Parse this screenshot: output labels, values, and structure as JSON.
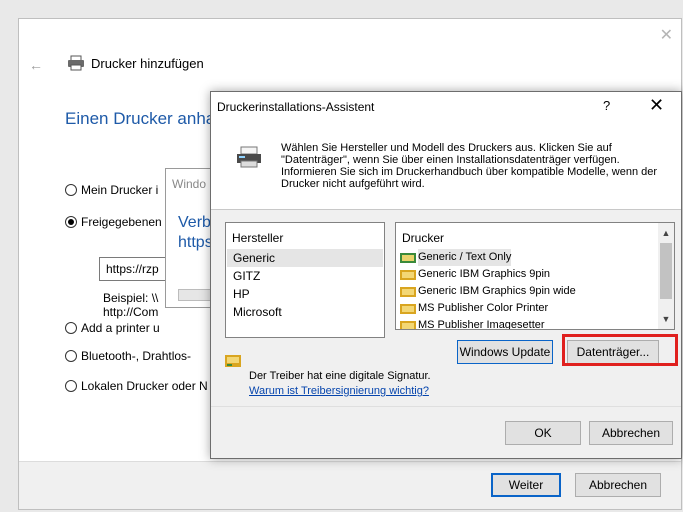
{
  "outer": {
    "title": "Drucker hinzufügen",
    "close_glyph": "✕",
    "back_glyph": "←",
    "heading": "Einen Drucker anha",
    "options": [
      {
        "label": "Mein Drucker i",
        "selected": false
      },
      {
        "label": "Freigegebenen",
        "selected": true
      },
      {
        "label": "Add a printer u",
        "selected": false
      },
      {
        "label": "Bluetooth-, Drahtlos-",
        "selected": false
      },
      {
        "label": "Lokalen Drucker oder N",
        "selected": false
      }
    ],
    "url_value": "https://rzp",
    "example_line1": "Beispiel: \\\\",
    "example_line2": "http://Com",
    "next_button": "Weiter",
    "cancel_button": "Abbrechen"
  },
  "middle": {
    "title": "Windo",
    "heading_line1": "Verb",
    "heading_line2": "https"
  },
  "dialog": {
    "title": "Druckerinstallations-Assistent",
    "help_glyph": "?",
    "close_glyph": "✕",
    "description": "Wählen Sie Hersteller und Modell des Druckers aus. Klicken Sie auf\n\"Datenträger\", wenn Sie über einen Installationsdatenträger verfügen.\nInformieren Sie sich im Druckerhandbuch über kompatible Modelle, wenn der\nDrucker nicht aufgeführt wird.",
    "manufacturer_header": "Hersteller",
    "manufacturers": [
      "Generic",
      "GITZ",
      "HP",
      "Microsoft"
    ],
    "selected_manufacturer": "Generic",
    "printer_header": "Drucker",
    "printers": [
      "Generic / Text Only",
      "Generic IBM Graphics 9pin",
      "Generic IBM Graphics 9pin wide",
      "MS Publisher Color Printer",
      "MS Publisher Imagesetter"
    ],
    "selected_printer": "Generic / Text Only",
    "windows_update_button": "Windows Update",
    "disk_button": "Datenträger...",
    "signature_text": "Der Treiber hat eine digitale Signatur.",
    "signature_link": "Warum ist Treibersignierung wichtig?",
    "ok_button": "OK",
    "cancel_button": "Abbrechen",
    "scroll_up_glyph": "▲",
    "scroll_down_glyph": "▼"
  },
  "colors": {
    "accent": "#0a64c8",
    "heading_blue": "#1e5aa8",
    "link": "#0645ad",
    "highlight_red": "#e0201e"
  }
}
